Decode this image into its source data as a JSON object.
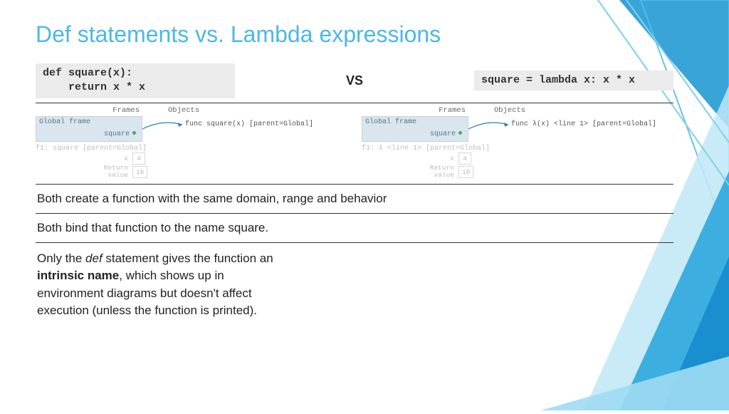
{
  "title": "Def statements vs. Lambda expressions",
  "code": {
    "def": "def square(x):\n    return x * x",
    "vs": "VS",
    "lambda": "square = lambda x: x * x"
  },
  "diagram": {
    "headers": {
      "frames": "Frames",
      "objects": "Objects"
    },
    "global_label": "Global frame",
    "var_name": "square",
    "func_def": "func square(x) [parent=Global]",
    "func_lambda": "func λ(x) <line 1> [parent=Global]",
    "f1_def": "f1: square [parent=Global]",
    "f1_lambda": "f1: λ <line 1> [parent=Global]",
    "x_label": "x",
    "x_val": "4",
    "ret_label": "Return\nvalue",
    "ret_val": "16"
  },
  "bullets": {
    "b1": "Both create a function with the same domain, range and behavior",
    "b2": "Both bind that function to the name square.",
    "b3_pre": "Only the ",
    "b3_em": "def",
    "b3_mid": " statement gives the function an ",
    "b3_strong": "intrinsic name",
    "b3_post": ", which shows up in environment diagrams but doesn't affect execution (unless the function is printed)."
  }
}
